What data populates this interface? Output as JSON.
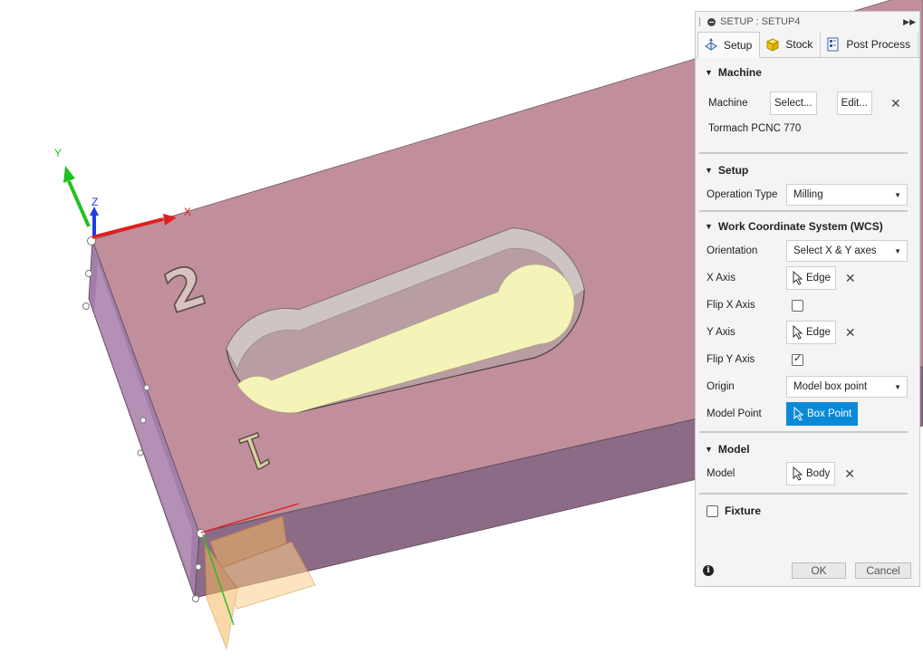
{
  "viewport": {
    "axes": {
      "x_label": "X",
      "y_label": "Y",
      "z_label": "Z"
    },
    "engravings": [
      "2",
      "1"
    ],
    "colors": {
      "body_top": "#c08f9b",
      "body_side": "#8c6b86",
      "slot_floor": "#f4f3b8",
      "x_axis": "#e01f1f",
      "y_axis": "#21c021",
      "z_axis": "#1f3ce0",
      "origin_box": "#f6b961"
    }
  },
  "panel": {
    "title": "SETUP : SETUP4",
    "tabs": [
      {
        "label": "Setup",
        "icon": "setup-icon"
      },
      {
        "label": "Stock",
        "icon": "stock-cube-icon"
      },
      {
        "label": "Post Process",
        "icon": "post-process-icon"
      }
    ],
    "machine": {
      "heading": "Machine",
      "label": "Machine",
      "select_label": "Select...",
      "edit_label": "Edit...",
      "clear_label": "✕",
      "machine_name": "Tormach PCNC 770"
    },
    "setup": {
      "heading": "Setup",
      "operation_type_label": "Operation Type",
      "operation_type_value": "Milling"
    },
    "wcs": {
      "heading": "Work Coordinate System (WCS)",
      "orientation_label": "Orientation",
      "orientation_value": "Select X & Y axes",
      "x_axis_label": "X Axis",
      "x_axis_value": "Edge",
      "flip_x_label": "Flip X Axis",
      "flip_x_checked": false,
      "y_axis_label": "Y Axis",
      "y_axis_value": "Edge",
      "flip_y_label": "Flip Y Axis",
      "flip_y_checked": true,
      "origin_label": "Origin",
      "origin_value": "Model box point",
      "model_point_label": "Model Point",
      "model_point_value": "Box Point",
      "clear_label": "✕"
    },
    "model": {
      "heading": "Model",
      "label": "Model",
      "value": "Body",
      "clear_label": "✕"
    },
    "fixture": {
      "label": "Fixture",
      "checked": false
    },
    "footer": {
      "info": "i",
      "ok_label": "OK",
      "cancel_label": "Cancel"
    }
  }
}
